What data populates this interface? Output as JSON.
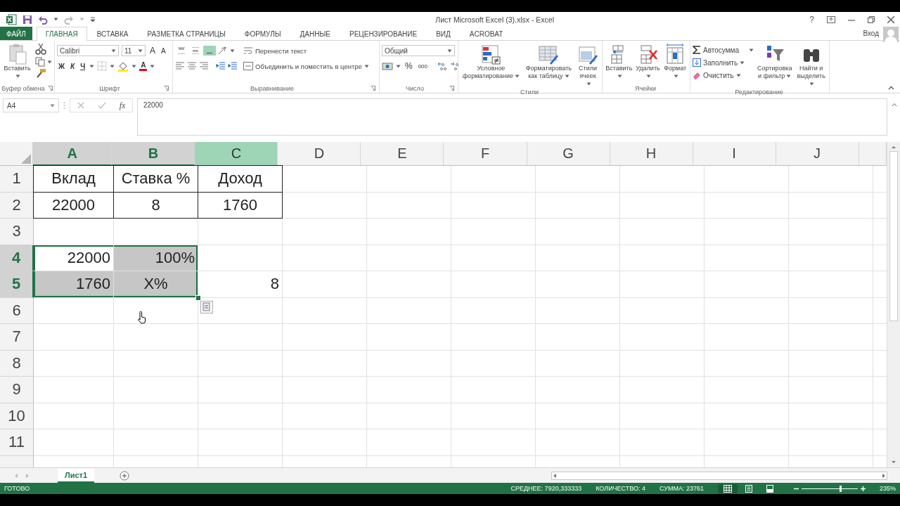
{
  "window": {
    "title": "Лист Microsoft Excel (3).xlsx - Excel",
    "help": "?",
    "account": "Вход"
  },
  "ribbon_tabs": [
    {
      "label": "ФАЙЛ",
      "kind": "file",
      "selected": false
    },
    {
      "label": "ГЛАВНАЯ",
      "kind": "tab",
      "selected": true
    },
    {
      "label": "ВСТАВКА",
      "kind": "tab",
      "selected": false
    },
    {
      "label": "РАЗМЕТКА СТРАНИЦЫ",
      "kind": "tab",
      "selected": false
    },
    {
      "label": "ФОРМУЛЫ",
      "kind": "tab",
      "selected": false
    },
    {
      "label": "ДАННЫЕ",
      "kind": "tab",
      "selected": false
    },
    {
      "label": "РЕЦЕНЗИРОВАНИЕ",
      "kind": "tab",
      "selected": false
    },
    {
      "label": "ВИД",
      "kind": "tab",
      "selected": false
    },
    {
      "label": "ACROBAT",
      "kind": "tab",
      "selected": false
    }
  ],
  "ribbon_groups": [
    {
      "kind": "clipboard",
      "title": "Буфер обмена",
      "paste": "Вставить"
    },
    {
      "kind": "font",
      "title": "Шрифт",
      "font_name": "Calibri",
      "font_size": "11",
      "grow_font": "A",
      "shrink_font": "A",
      "bold": "Ж",
      "italic": "К",
      "underline": "Ч",
      "font_color": "A"
    },
    {
      "kind": "alignment",
      "title": "Выравнивание",
      "vertical_align": [
        {
          "selected": false
        },
        {
          "selected": false
        },
        {
          "selected": true
        }
      ],
      "wrap_text": "Перенести текст",
      "merge": "Объединить и поместить в центре"
    },
    {
      "kind": "number",
      "title": "Число",
      "format": "Общий",
      "percent": "%",
      "thousands": "000"
    },
    {
      "kind": "styles",
      "title": "Стили",
      "buttons": [
        "Условное форматирование",
        "Форматировать как таблицу",
        "Стили ячеек"
      ]
    },
    {
      "kind": "cells",
      "title": "Ячейки",
      "buttons": [
        "Вставить",
        "Удалить",
        "Формат"
      ]
    },
    {
      "kind": "editing",
      "title": "Редактирование",
      "autosum": "Автосумма",
      "fill": "Заполнить",
      "clear": "Очистить",
      "sort": "Сортировка и фильтр",
      "find": "Найти и выделить"
    }
  ],
  "formula_bar": {
    "name_box": "A4",
    "fx": "fx",
    "formula": "22000"
  },
  "columns": [
    {
      "label": "A",
      "selected": true,
      "highlighted": false
    },
    {
      "label": "B",
      "selected": true,
      "highlighted": false
    },
    {
      "label": "C",
      "selected": false,
      "highlighted": true
    },
    {
      "label": "D",
      "selected": false,
      "highlighted": false
    },
    {
      "label": "E",
      "selected": false,
      "highlighted": false
    },
    {
      "label": "F",
      "selected": false,
      "highlighted": false
    },
    {
      "label": "G",
      "selected": false,
      "highlighted": false
    },
    {
      "label": "H",
      "selected": false,
      "highlighted": false
    },
    {
      "label": "I",
      "selected": false,
      "highlighted": false
    },
    {
      "label": "J",
      "selected": false,
      "highlighted": false
    }
  ],
  "rows": [
    {
      "label": "1",
      "selected": false,
      "cells": [
        {
          "value": "Вклад",
          "centered": true,
          "bordered": true,
          "selected": false,
          "shaded": false
        },
        {
          "value": "Ставка %",
          "centered": true,
          "bordered": true,
          "selected": false,
          "shaded": false
        },
        {
          "value": "Доход",
          "centered": true,
          "bordered": true,
          "selected": false,
          "shaded": false
        }
      ]
    },
    {
      "label": "2",
      "selected": false,
      "cells": [
        {
          "value": "22000",
          "centered": true,
          "bordered": true,
          "selected": false,
          "shaded": false
        },
        {
          "value": "8",
          "centered": true,
          "bordered": true,
          "selected": false,
          "shaded": false
        },
        {
          "value": "1760",
          "centered": true,
          "bordered": true,
          "selected": false,
          "shaded": false
        }
      ]
    },
    {
      "label": "3",
      "selected": false
    },
    {
      "label": "4",
      "selected": true,
      "cells": [
        {
          "value": "22000",
          "centered": false,
          "bordered": false,
          "selected": true,
          "shaded": false
        },
        {
          "value": "100%",
          "centered": false,
          "bordered": false,
          "selected": true,
          "shaded": true
        }
      ]
    },
    {
      "label": "5",
      "selected": true,
      "cells": [
        {
          "value": "1760",
          "centered": false,
          "bordered": false,
          "selected": true,
          "shaded": true
        },
        {
          "value": "X%",
          "centered": true,
          "bordered": false,
          "selected": true,
          "shaded": true
        },
        {
          "value": "8",
          "centered": false,
          "bordered": false,
          "selected": false,
          "shaded": false
        }
      ]
    },
    {
      "label": "6",
      "selected": false
    },
    {
      "label": "7",
      "selected": false
    },
    {
      "label": "8",
      "selected": false
    },
    {
      "label": "9",
      "selected": false
    },
    {
      "label": "10",
      "selected": false
    },
    {
      "label": "11",
      "selected": false
    }
  ],
  "sheet_tabs": [
    {
      "label": "Лист1",
      "selected": true
    }
  ],
  "status_bar": {
    "mode": "ГОТОВО",
    "stats": [
      "СРЕДНЕЕ: 7920,333333",
      "КОЛИЧЕСТВО: 4",
      "СУММА: 23761"
    ],
    "views": [
      {
        "kind": "normal",
        "selected": true
      },
      {
        "kind": "page_layout",
        "selected": false
      },
      {
        "kind": "page_break",
        "selected": false
      }
    ],
    "zoom": {
      "level": 0.69,
      "label": "235%"
    }
  }
}
